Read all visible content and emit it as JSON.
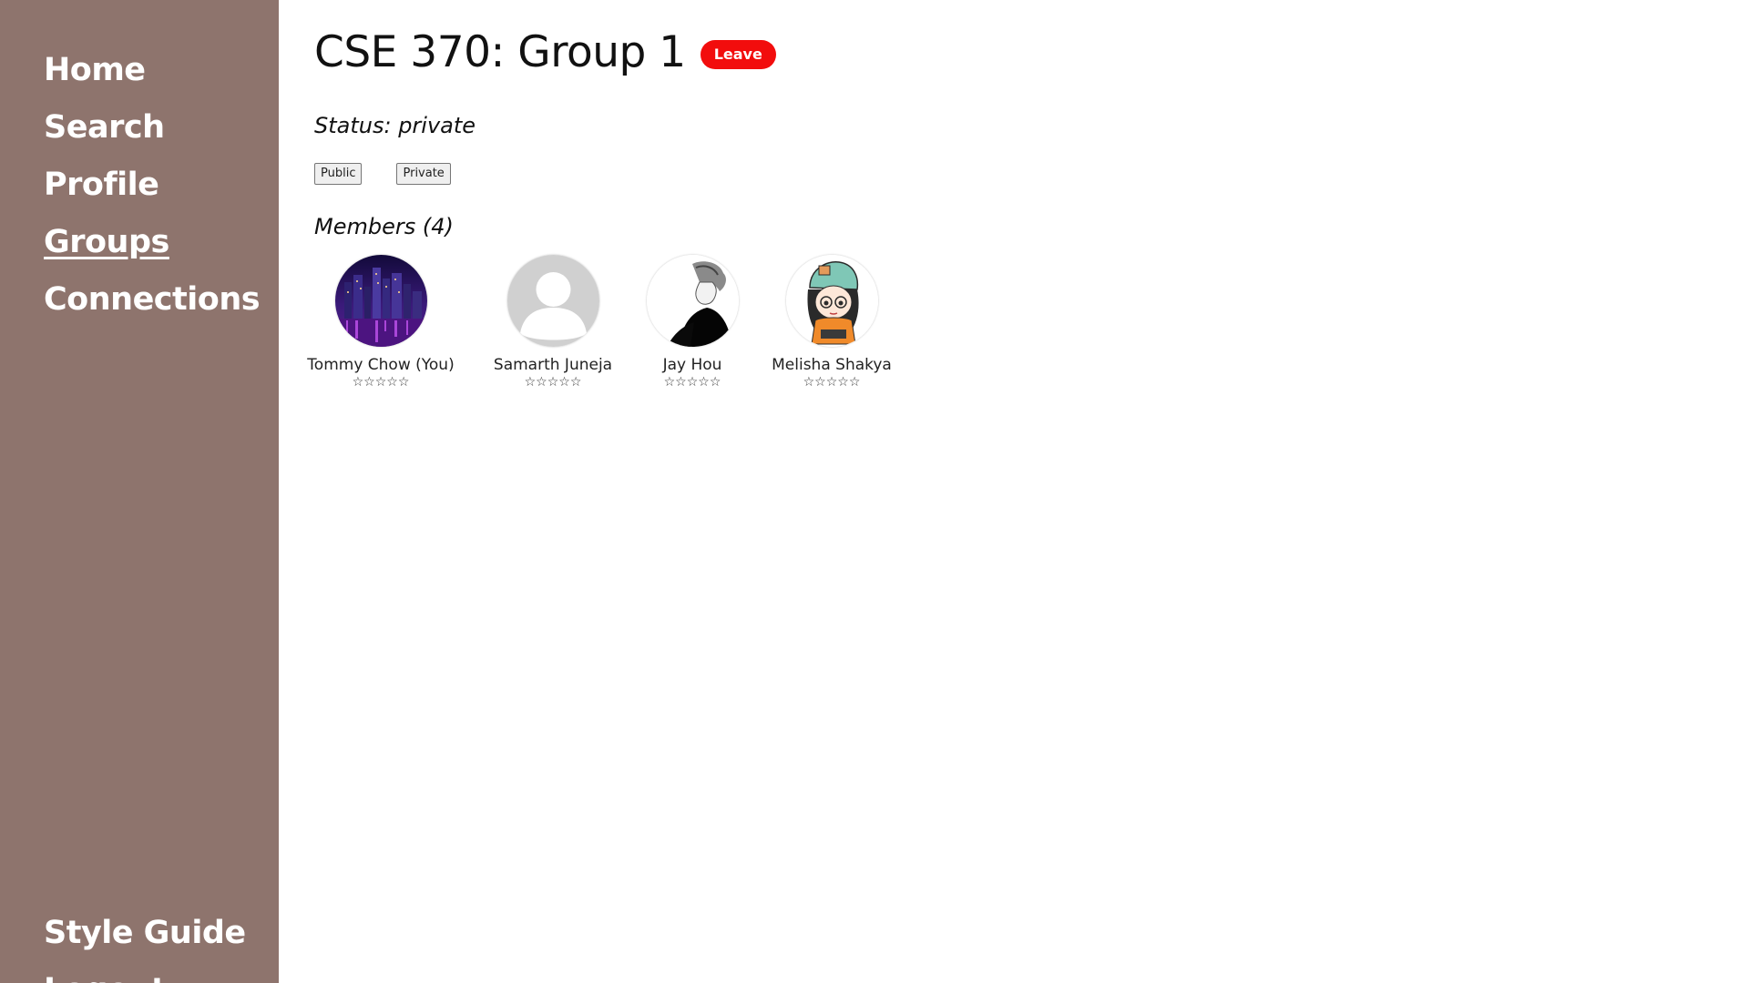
{
  "sidebar": {
    "items": [
      {
        "label": "Home",
        "active": false
      },
      {
        "label": "Search",
        "active": false
      },
      {
        "label": "Profile",
        "active": false
      },
      {
        "label": "Groups",
        "active": true
      },
      {
        "label": "Connections",
        "active": false
      }
    ],
    "bottom_items": [
      {
        "label": "Style Guide"
      },
      {
        "label": "Logout"
      }
    ],
    "background_color": "#8e746d"
  },
  "group": {
    "title": "CSE 370: Group 1",
    "leave_label": "Leave",
    "leave_color": "#f20d0d",
    "status_text": "Status: private",
    "public_label": "Public",
    "private_label": "Private",
    "members_heading": "Members (4)"
  },
  "members": [
    {
      "name": "Tommy Chow (You)",
      "rating": "☆☆☆☆☆",
      "avatar": "city-night-avatar"
    },
    {
      "name": "Samarth Juneja",
      "rating": "☆☆☆☆☆",
      "avatar": "default-user-avatar"
    },
    {
      "name": "Jay Hou",
      "rating": "☆☆☆☆☆",
      "avatar": "portrait-sketch-avatar"
    },
    {
      "name": "Melisha Shakya",
      "rating": "☆☆☆☆☆",
      "avatar": "cartoon-girl-avatar"
    }
  ]
}
